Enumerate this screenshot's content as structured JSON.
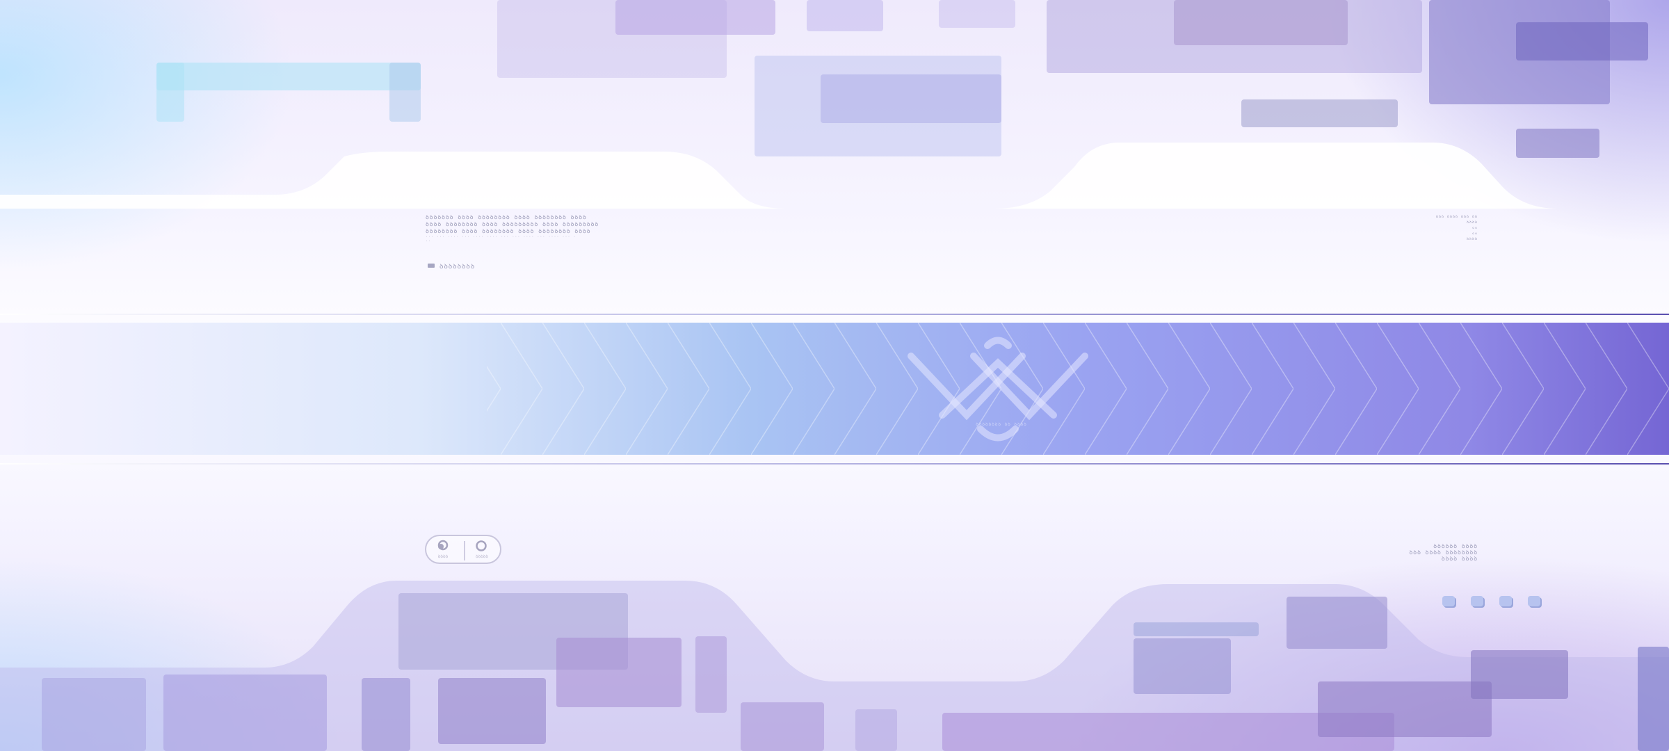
{
  "intro": {
    "title_line_1": "ꝺꝺꝺꝺꝺꝺꝺ ꝺꝺꝺꝺ ꝺꝺꝺꝺꝺꝺꝺꝺ ꝺꝺꝺꝺ ꝺꝺꝺꝺꝺꝺꝺꝺ ꝺꝺꝺꝺ",
    "title_line_2": "ꝺꝺꝺꝺ ꝺꝺꝺꝺꝺꝺꝺꝺ ꝺꝺꝺꝺ ꝺꝺꝺꝺꝺꝺꝺꝺꝺ ꝺꝺꝺꝺ ꝺꝺꝺꝺꝺꝺꝺꝺꝺ",
    "title_line_3": "ꝺꝺꝺꝺꝺꝺꝺꝺ ꝺꝺꝺꝺ ꝺꝺꝺꝺꝺꝺꝺꝺ ꝺꝺꝺꝺ ꝺꝺꝺꝺꝺꝺꝺꝺ ꝺꝺꝺꝺ",
    "fine_print": "··· ··· ···· ··· ···· ···· ··· ··· ···· ··· ···· ··· ···",
    "tag_label": "ꝺꝺꝺꝺꝺꝺꝺꝺ"
  },
  "top_right_info": [
    "ꝺꝺꝺ ꝺꝺꝺꝺ ꝺꝺꝺ ꝺꝺ",
    "ꝺꝺꝺꝺ",
    "◇◇",
    "◇◇",
    "ꝺꝺꝺꝺ"
  ],
  "emblem": {
    "caption": "ꝺꝺꝺꝺꝺꝺꝺꝺ ꝺꝺ ꝺꝺꝺꝺ"
  },
  "mode_switch": {
    "left_label": "ꝺꝺꝺꝺ",
    "right_label": "ꝺꝺꝺꝺꝺ"
  },
  "bottom_right_info": [
    "ꝺꝺꝺꝺꝺꝺ ꝺꝺꝺꝺ",
    "ꝺꝺꝺ ꝺꝺꝺꝺ ꝺꝺꝺꝺꝺꝺꝺꝺ",
    "ꝺꝺꝺꝺ ꝺꝺꝺꝺ"
  ],
  "page_dots": {
    "count": 4,
    "active": 0
  },
  "colors": {
    "band_start": "#f4f2ff",
    "band_mid": "#a9c4f3",
    "band_end": "#7566d4",
    "text_muted": "#9a9ab8"
  }
}
